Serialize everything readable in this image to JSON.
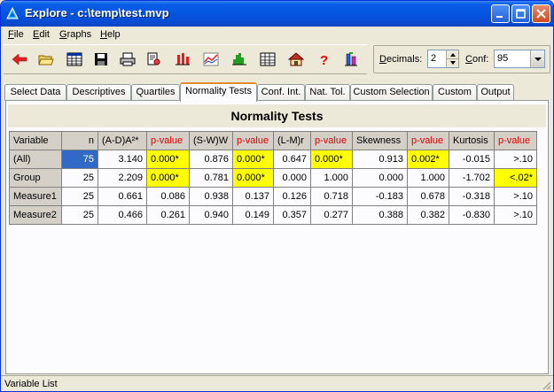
{
  "window": {
    "title": "Explore - c:\\temp\\test.mvp"
  },
  "menu": [
    {
      "label": "File",
      "u": "F",
      "rest": "ile"
    },
    {
      "label": "Edit",
      "u": "E",
      "rest": "dit"
    },
    {
      "label": "Graphs",
      "u": "G",
      "rest": "raphs"
    },
    {
      "label": "Help",
      "u": "H",
      "rest": "elp"
    }
  ],
  "toolbar": {
    "icons": [
      "back-arrow-icon",
      "open-folder-icon",
      "grid-icon",
      "save-icon",
      "print-icon",
      "print-preview-icon",
      "bar-markers-icon",
      "line-chart-icon",
      "histogram-icon",
      "table-icon",
      "home-icon",
      "help-icon",
      "boxplot-icon"
    ]
  },
  "options": {
    "decimals_label": "Decimals:",
    "decimals_u": "D",
    "decimals_rest": "ecimals:",
    "decimals_value": "2",
    "conf_label": "Conf:",
    "conf_u": "C",
    "conf_rest": "onf:",
    "conf_value": "95"
  },
  "tabs": [
    "Select Data",
    "Descriptives",
    "Quartiles",
    "Normality Tests",
    "Conf. Int.",
    "Nat. Tol.",
    "Custom Selection",
    "Custom",
    "Output"
  ],
  "active_tab": "Normality Tests",
  "grid": {
    "title": "Normality Tests",
    "headers": [
      "Variable",
      "n",
      "(A-D)A²*",
      "p-value",
      "(S-W)W",
      "p-value",
      "(L-M)r",
      "p-value",
      "Skewness",
      "p-value",
      "Kurtosis",
      "p-value"
    ],
    "rows": [
      [
        "(All)",
        "75",
        "3.140",
        "0.000*",
        "0.876",
        "0.000*",
        "0.647",
        "0.000*",
        "0.913",
        "0.002*",
        "-0.015",
        ">.10"
      ],
      [
        "Group",
        "25",
        "2.209",
        "0.000*",
        "0.781",
        "0.000*",
        "0.000",
        "1.000",
        "0.000",
        "1.000",
        "-1.702",
        "<.02*"
      ],
      [
        "Measure1",
        "25",
        "0.661",
        "0.086",
        "0.938",
        "0.137",
        "0.126",
        "0.718",
        "-0.183",
        "0.678",
        "-0.318",
        ">.10"
      ],
      [
        "Measure2",
        "25",
        "0.466",
        "0.261",
        "0.940",
        "0.149",
        "0.357",
        "0.277",
        "0.388",
        "0.382",
        "-0.830",
        ">.10"
      ]
    ],
    "highlight_color": "#ffff00",
    "pvalue_header_color": "#e00000",
    "selection_color": "#3169c6"
  },
  "status": {
    "text": "Variable List"
  }
}
